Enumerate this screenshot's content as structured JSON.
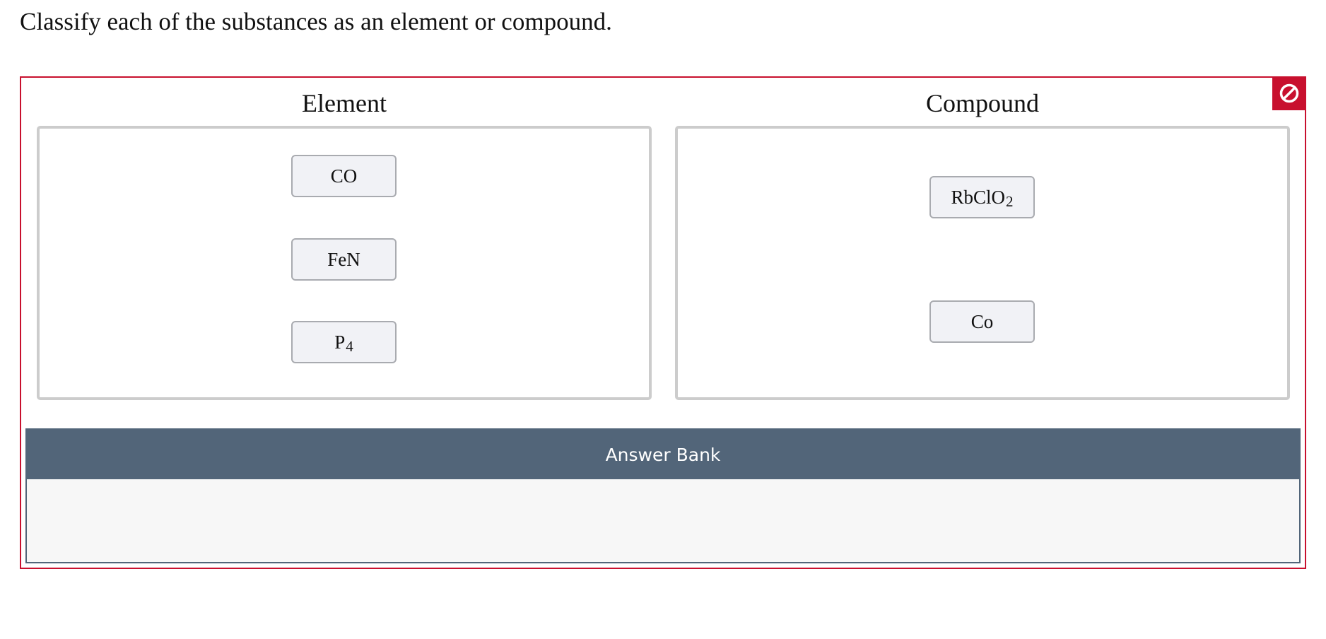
{
  "prompt": "Classify each of the substances as an element or compound.",
  "reset_icon": "no-entry-icon",
  "colors": {
    "accent_red": "#c8102e",
    "bank_header": "#526579",
    "tile_bg": "#f1f2f6",
    "bin_border": "#cccccc"
  },
  "columns": {
    "element": {
      "title": "Element",
      "items": [
        {
          "main": "CO",
          "sub": ""
        },
        {
          "main": "FeN",
          "sub": ""
        },
        {
          "main": "P",
          "sub": "4"
        }
      ]
    },
    "compound": {
      "title": "Compound",
      "items": [
        {
          "main": "RbClO",
          "sub": "2"
        },
        {
          "main": "Co",
          "sub": ""
        }
      ]
    }
  },
  "answer_bank": {
    "title": "Answer Bank",
    "items": []
  }
}
